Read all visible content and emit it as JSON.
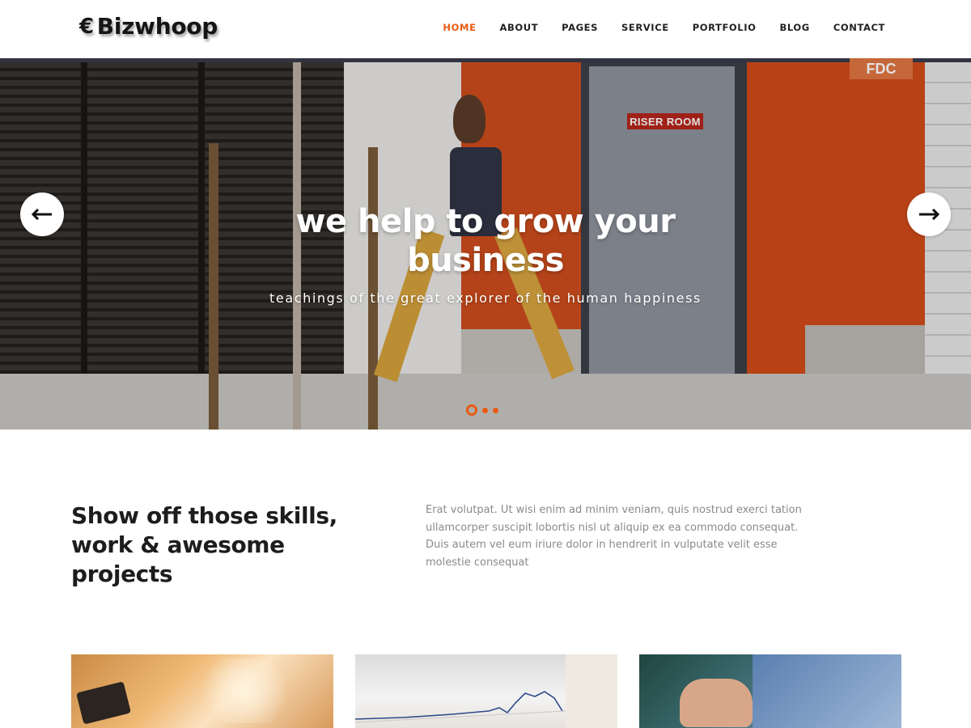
{
  "brand": {
    "icon": "€",
    "name": "Bizwhoop"
  },
  "nav": {
    "items": [
      "HOME",
      "ABOUT",
      "PAGES",
      "SERVICE",
      "PORTFOLIO",
      "BLOG",
      "CONTACT"
    ],
    "active": "HOME",
    "accent_color": "#e85a13"
  },
  "hero": {
    "title": "we help to grow your business",
    "subtitle": "teachings of the great explorer of the human happiness",
    "sign_text": "RISER ROOM",
    "sign_text2": "FDC",
    "prev_icon": "arrow-left-icon",
    "next_icon": "arrow-right-icon",
    "slides_count": 3,
    "active_slide": 1
  },
  "about": {
    "heading": "Show off those skills, work & awesome projects",
    "text": "Erat volutpat. Ut wisi enim ad minim veniam, quis nostrud exerci tation ullamcorper suscipit lobortis nisl ut aliquip ex ea commodo consequat. Duis autem vel eum iriure dolor in hendrerit in vulputate velit esse molestie consequat"
  }
}
